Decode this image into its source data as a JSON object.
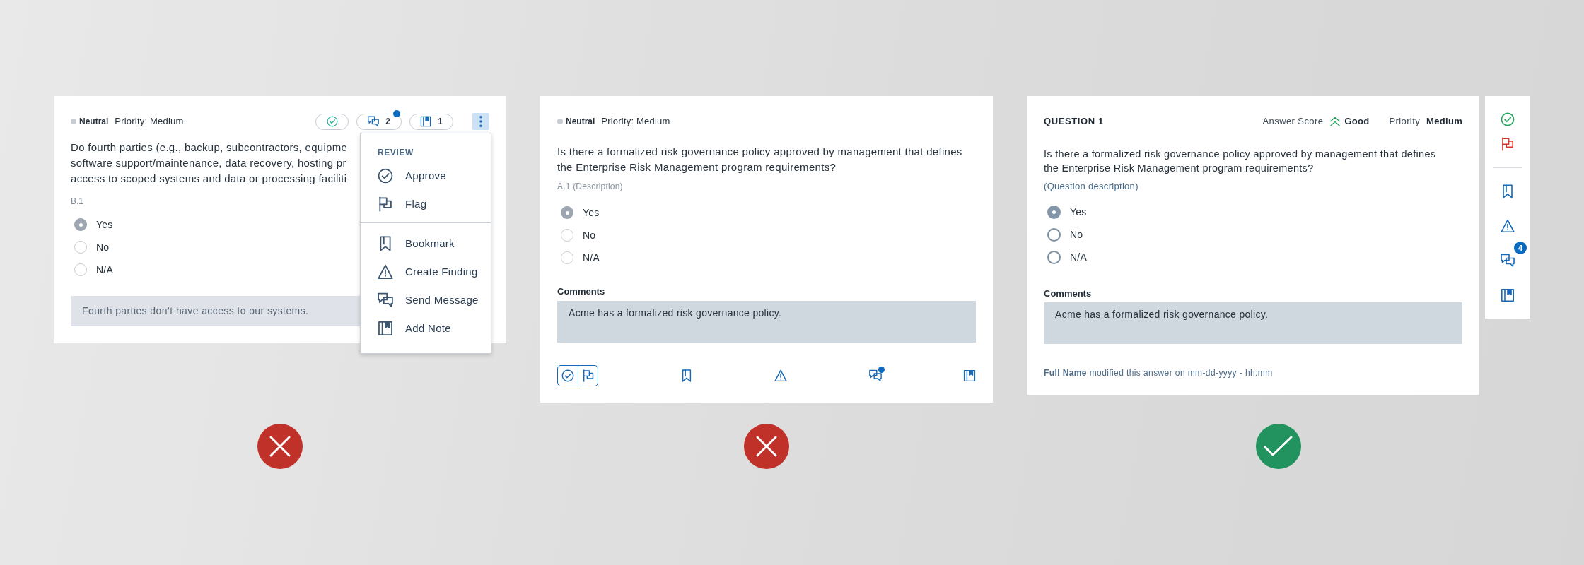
{
  "examples": [
    {
      "kind": "dropdown",
      "correct": false,
      "header": {
        "status": "Neutral",
        "priority": "Priority: Medium"
      },
      "chips": [
        {
          "kind": "approve"
        },
        {
          "kind": "messages",
          "count": "2",
          "unread": true
        },
        {
          "kind": "notes",
          "count": "1"
        }
      ],
      "menu_button": {
        "expanded": true
      },
      "question_lines": [
        "Do fourth parties (e.g., backup, subcontractors, equipme",
        "software support/maintenance, data recovery, hosting pr",
        "access to scoped systems and data or processing faciliti"
      ],
      "reference": "B.1",
      "options": [
        {
          "label": "Yes",
          "selected": true
        },
        {
          "label": "No",
          "selected": false
        },
        {
          "label": "N/A",
          "selected": false
        }
      ],
      "comment": "Fourth parties don’t have access to our systems.",
      "menu": {
        "title": "REVIEW",
        "groups": [
          [
            {
              "kind": "approve",
              "label": "Approve"
            },
            {
              "kind": "flag",
              "label": "Flag"
            }
          ],
          [
            {
              "kind": "bookmark",
              "label": "Bookmark"
            },
            {
              "kind": "finding",
              "label": "Create Finding"
            },
            {
              "kind": "message",
              "label": "Send Message"
            },
            {
              "kind": "note",
              "label": "Add Note"
            }
          ]
        ]
      }
    },
    {
      "kind": "toolbar",
      "correct": false,
      "header": {
        "status": "Neutral",
        "priority": "Priority: Medium"
      },
      "question": "Is there a formalized risk governance policy approved by management that defines the Enterprise Risk Management program requirements?",
      "reference": "A.1 (Description)",
      "options": [
        {
          "label": "Yes",
          "selected": true
        },
        {
          "label": "No",
          "selected": false
        },
        {
          "label": "N/A",
          "selected": false
        }
      ],
      "comments_label": "Comments",
      "comment": "Acme has a formalized risk governance policy.",
      "toolbar": {
        "review_group": [
          {
            "kind": "approve"
          },
          {
            "kind": "flag"
          }
        ],
        "actions": [
          {
            "kind": "bookmark"
          },
          {
            "kind": "finding"
          },
          {
            "kind": "message",
            "unread": true
          },
          {
            "kind": "note"
          }
        ]
      }
    },
    {
      "kind": "sidebar",
      "correct": true,
      "title": "QUESTION 1",
      "score": {
        "label": "Answer Score",
        "value": "Good"
      },
      "priority": {
        "label": "Priority",
        "value": "Medium"
      },
      "question": "Is there a formalized risk governance policy approved by management that defines the Enterprise Risk Management program requirements?",
      "description": "(Question description)",
      "options": [
        {
          "label": "Yes",
          "selected": true
        },
        {
          "label": "No",
          "selected": false
        },
        {
          "label": "N/A",
          "selected": false
        }
      ],
      "comments_label": "Comments",
      "comment": "Acme has a formalized risk governance policy.",
      "footer": "**Full Name** modified this answer on mm-dd-yyyy - hh:mm",
      "sidebar": [
        [
          {
            "kind": "approve"
          },
          {
            "kind": "flag"
          }
        ],
        [
          {
            "kind": "bookmark"
          },
          {
            "kind": "finding"
          },
          {
            "kind": "message",
            "count": "4"
          },
          {
            "kind": "note"
          }
        ]
      ]
    }
  ]
}
